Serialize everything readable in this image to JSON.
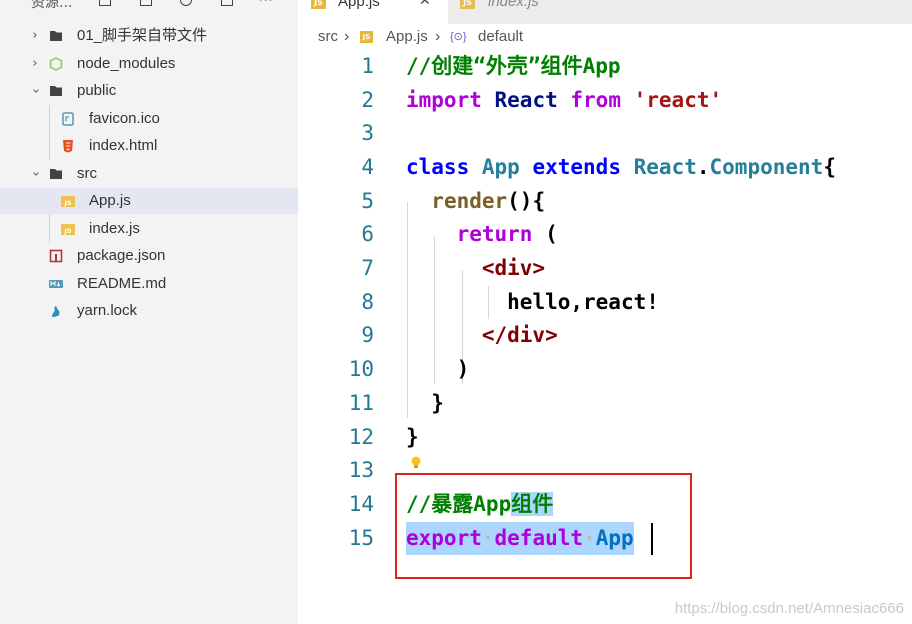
{
  "sidebar": {
    "title": "资源...",
    "items": [
      {
        "label": "01_脚手架自带文件"
      },
      {
        "label": "node_modules"
      },
      {
        "label": "public"
      },
      {
        "label": "favicon.ico"
      },
      {
        "label": "index.html"
      },
      {
        "label": "src"
      },
      {
        "label": "App.js"
      },
      {
        "label": "index.js"
      },
      {
        "label": "package.json"
      },
      {
        "label": "README.md"
      },
      {
        "label": "yarn.lock"
      }
    ]
  },
  "tabs": [
    {
      "label": "App.js",
      "badge": "JS",
      "close": "✕"
    },
    {
      "label": "index.js",
      "badge": "JS"
    }
  ],
  "breadcrumb": {
    "folder": "src",
    "file": "App.js",
    "symbol": "default",
    "separator": "›",
    "file_badge": "JS",
    "symbol_icon": "{⊙}"
  },
  "editor": {
    "line_numbers": [
      "1",
      "2",
      "3",
      "4",
      "5",
      "6",
      "7",
      "8",
      "9",
      "10",
      "11",
      "12",
      "13",
      "14",
      "15"
    ],
    "tokens": {
      "l1": "//创建“外壳”组件App",
      "l2_import": "import",
      "l2_react": "React",
      "l2_from": "from",
      "l2_str": "'react'",
      "l4_class": "class",
      "l4_app": "App",
      "l4_extends": "extends",
      "l4_react": "React",
      "l4_dot": ".",
      "l4_component": "Component",
      "l4_brace": "{",
      "l5_render": "render",
      "l5_rest": "(){",
      "l6_return": "return",
      "l6_paren": "(",
      "l7_tag": "<div>",
      "l8_text": "hello,react!",
      "l9_tag": "</div>",
      "l10_paren": ")",
      "l11_brace": "}",
      "l12_brace": "}",
      "l14_comment_a": "//暴露App",
      "l14_comment_b": "组件",
      "l15_export": "export",
      "l15_default": "default",
      "l15_app": "App",
      "ws_dot": "·"
    }
  },
  "colors": {
    "keyword": "#0000ff",
    "identifier": "#267f99",
    "function": "#795e26",
    "string": "#a31515",
    "comment": "#008000",
    "control": "#af00db",
    "tag": "#800000",
    "selection": "#add6ff",
    "highlight_box": "#e2231a",
    "line_number": "#237893"
  },
  "watermark": "https://blog.csdn.net/Amnesiac666"
}
